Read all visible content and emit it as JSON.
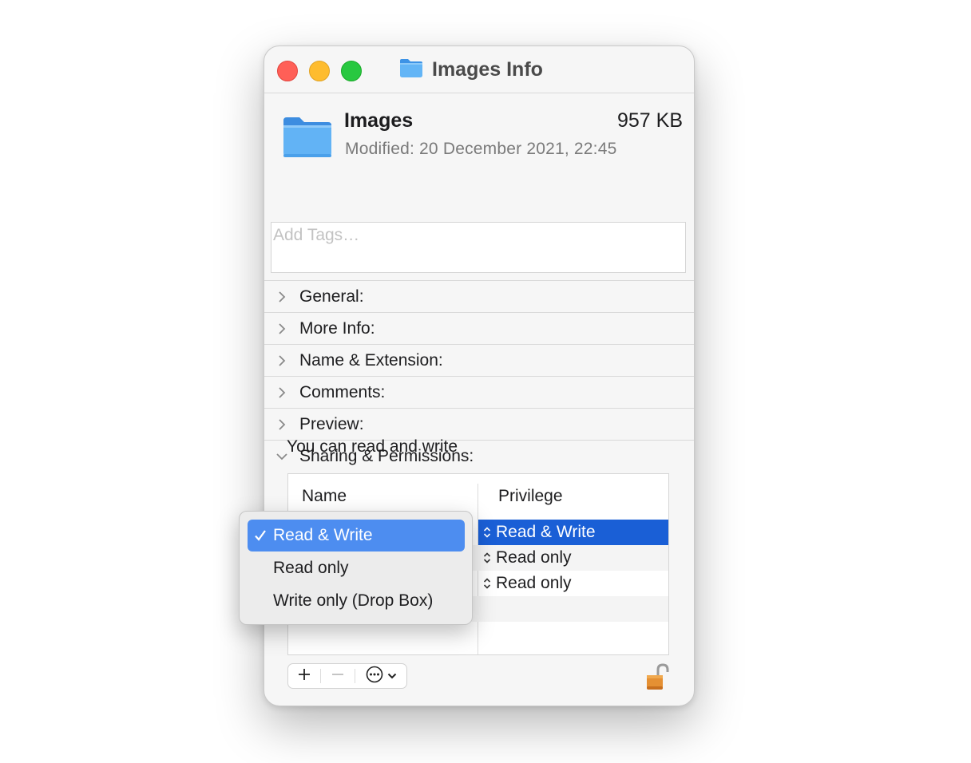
{
  "window": {
    "title": "Images Info"
  },
  "header": {
    "name": "Images",
    "size": "957 KB",
    "modified": "Modified: 20 December 2021, 22:45",
    "tags_placeholder": "Add Tags…"
  },
  "sections": [
    {
      "label": "General:",
      "expanded": false
    },
    {
      "label": "More Info:",
      "expanded": false
    },
    {
      "label": "Name & Extension:",
      "expanded": false
    },
    {
      "label": "Comments:",
      "expanded": false
    },
    {
      "label": "Preview:",
      "expanded": false
    },
    {
      "label": "Sharing & Permissions:",
      "expanded": true
    }
  ],
  "permissions": {
    "summary": "You can read and write",
    "columns": {
      "name": "Name",
      "privilege": "Privilege"
    },
    "rows": [
      {
        "privilege": "Read & Write",
        "selected": true
      },
      {
        "privilege": "Read only",
        "selected": false
      },
      {
        "privilege": "Read only",
        "selected": false
      }
    ]
  },
  "privilege_menu": {
    "items": [
      {
        "label": "Read & Write",
        "checked": true
      },
      {
        "label": "Read only",
        "checked": false
      },
      {
        "label": "Write only (Drop Box)",
        "checked": false
      }
    ]
  },
  "colors": {
    "accent": "#1a5fd6",
    "menu_highlight": "#4d8df0",
    "close": "#ff5f57",
    "minimize": "#febc2e",
    "maximize": "#28c840",
    "folder": "#5ab0f5"
  },
  "icons": {
    "folder": "folder-icon",
    "lock": "unlocked-lock-icon",
    "add": "plus-icon",
    "remove": "minus-icon",
    "action": "ellipsis-circle-icon"
  }
}
